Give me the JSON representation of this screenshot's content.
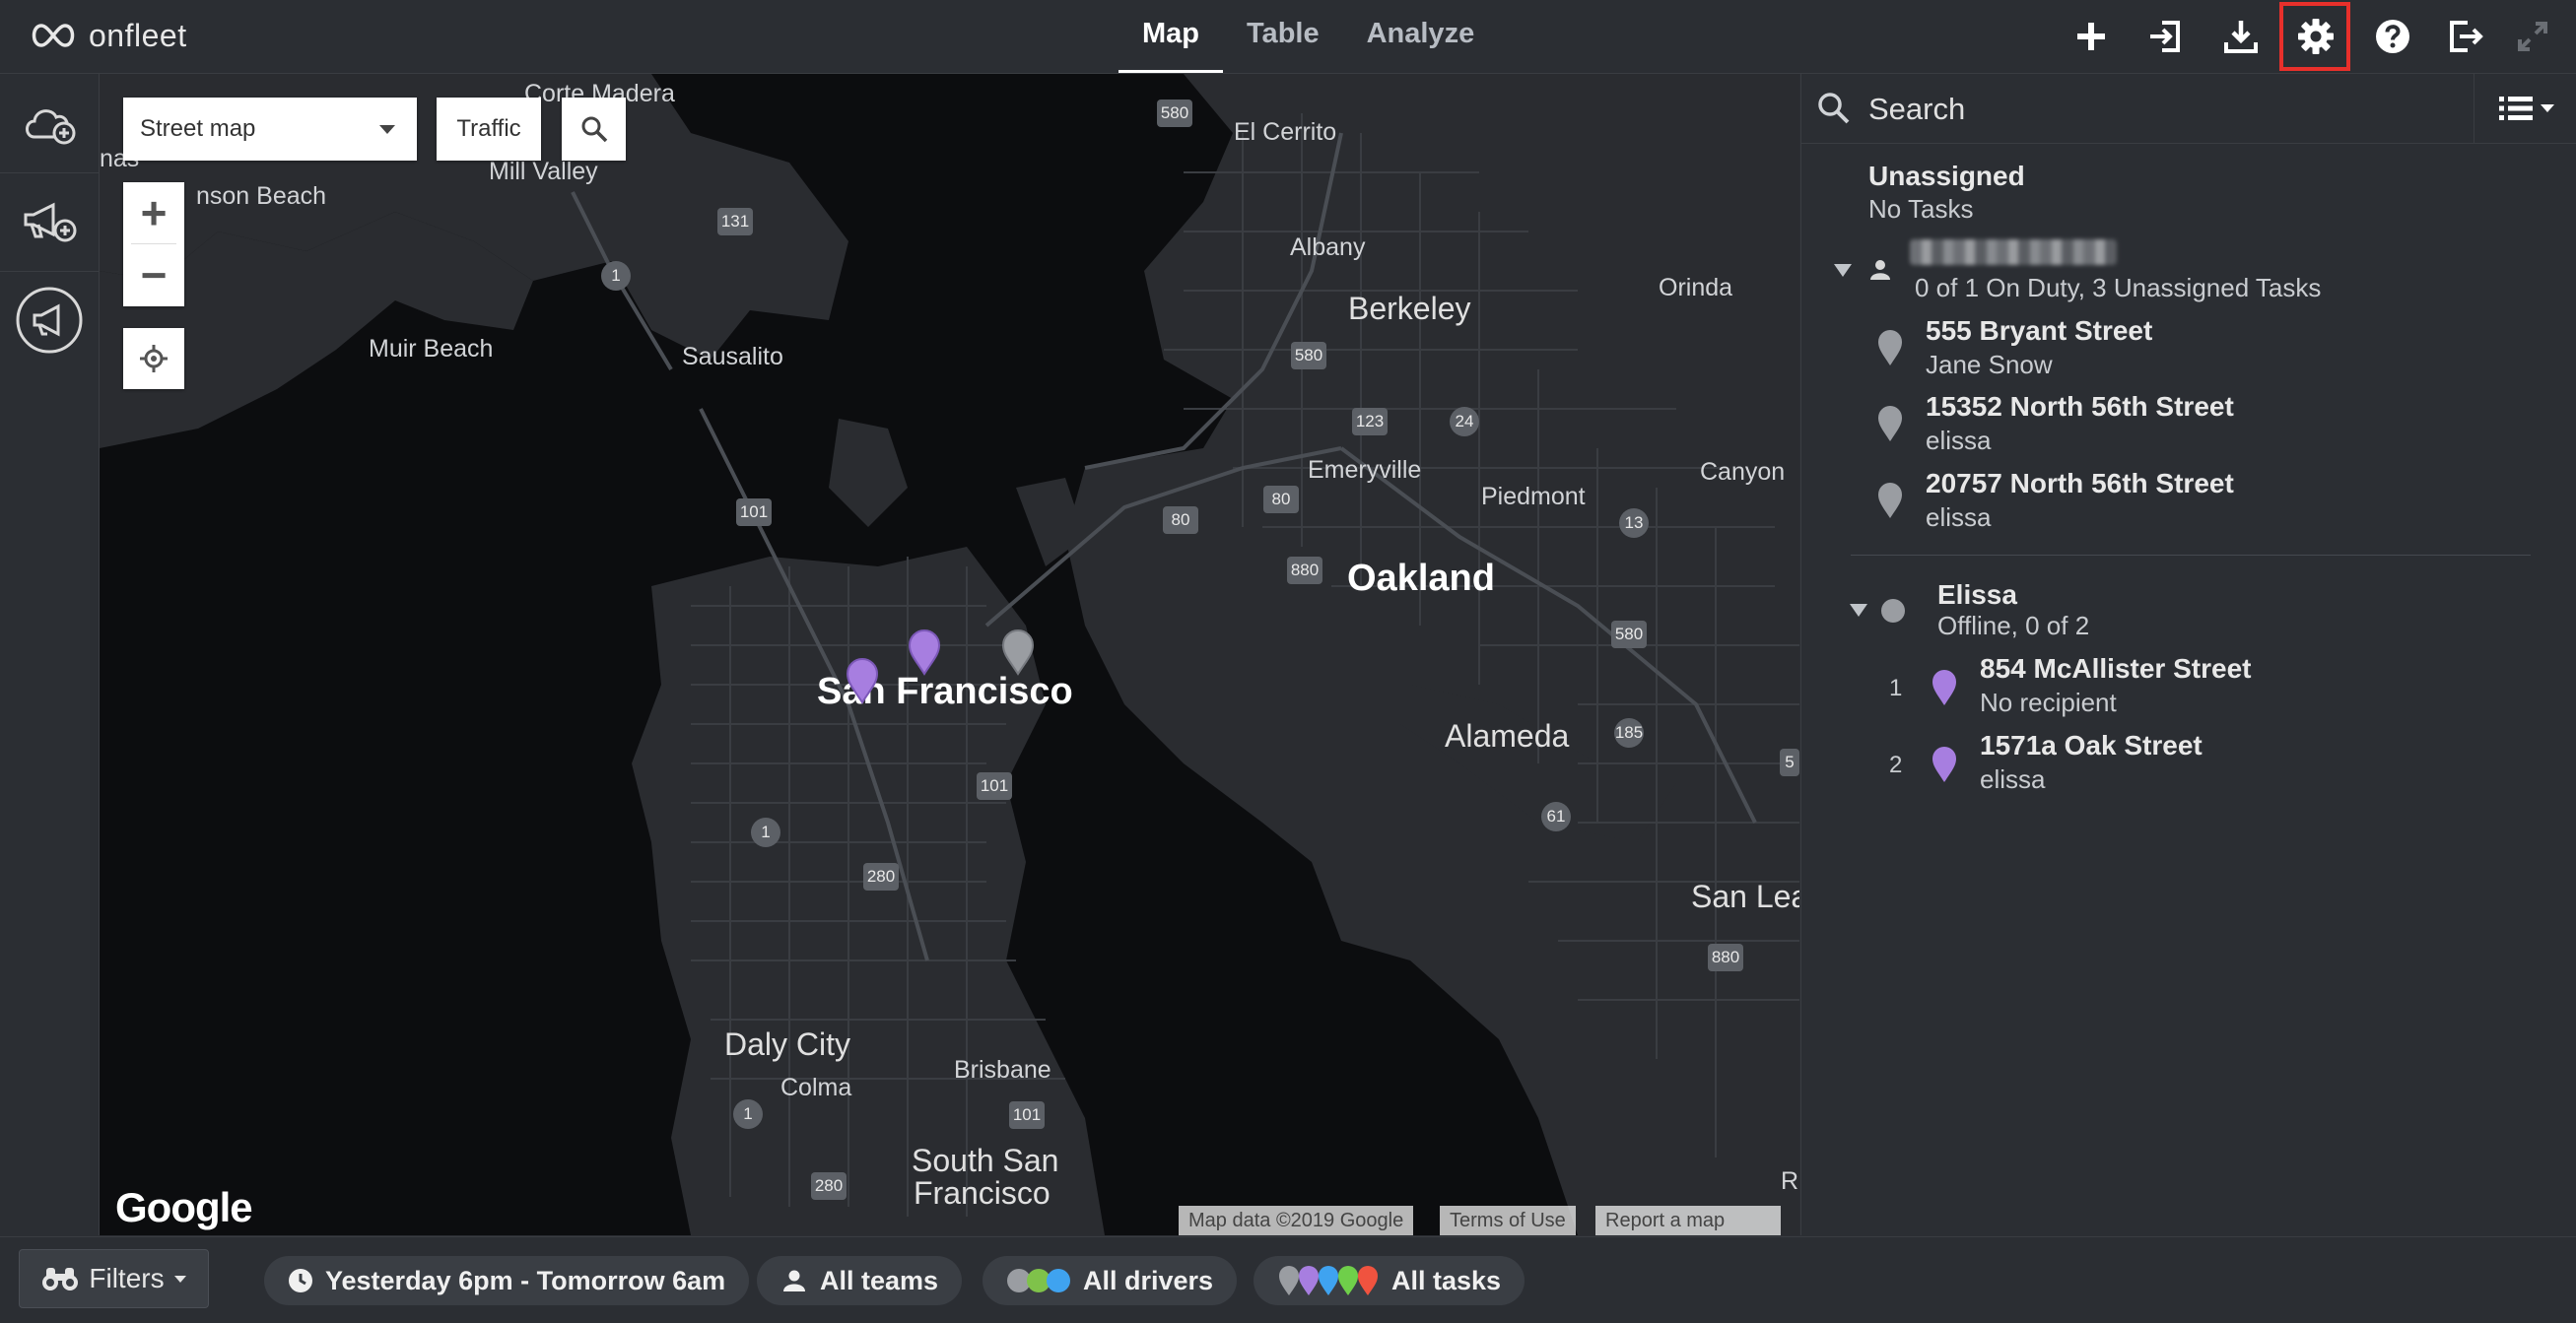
{
  "app": {
    "logo_text": "onfleet",
    "nav": [
      {
        "label": "Map",
        "active": true
      },
      {
        "label": "Table",
        "active": false
      },
      {
        "label": "Analyze",
        "active": false
      }
    ],
    "toolbar_icons": [
      "plus-icon",
      "import-icon",
      "download-icon",
      "gear-icon",
      "help-icon",
      "logout-icon",
      "fullscreen-icon"
    ],
    "highlight_color": "#e8302b"
  },
  "map": {
    "type_select": "Street map",
    "traffic_label": "Traffic",
    "zoom_in": "+",
    "zoom_out": "−",
    "google_logo": "Google",
    "attribution": {
      "data": "Map data ©2019 Google",
      "terms": "Terms of Use",
      "report": "Report a map error"
    },
    "labels": {
      "corte_madera": "Corte Madera",
      "mill_valley": "Mill Valley",
      "stinson_a": "nas",
      "stinson_b": "nson Beach",
      "muir_beach": "Muir Beach",
      "sausalito": "Sausalito",
      "el_cerrito": "El Cerrito",
      "albany": "Albany",
      "berkeley": "Berkeley",
      "orinda": "Orinda",
      "emeryville": "Emeryville",
      "piedmont": "Piedmont",
      "canyon": "Canyon",
      "oakland": "Oakland",
      "san_francisco": "San Francisco",
      "alameda": "Alameda",
      "san_leandro": "San Lea",
      "daly_city": "Daly City",
      "colma": "Colma",
      "brisbane": "Brisbane",
      "south_sf_1": "South San",
      "south_sf_2": "Francisco",
      "edge_r": "R"
    },
    "shields": {
      "s580a": "580",
      "s131": "131",
      "s1a": "1",
      "s580b": "580",
      "s123": "123",
      "s24": "24",
      "s101a": "101",
      "s80a": "80",
      "s80b": "80",
      "s880a": "880",
      "s13": "13",
      "s580c": "580",
      "s185": "185",
      "s101b": "101",
      "s1b": "1",
      "s280a": "280",
      "s61": "61",
      "s880b": "880",
      "s101c": "101",
      "s1c": "1",
      "s280b": "280",
      "s5": "5"
    }
  },
  "sidebar": {
    "search_placeholder": "Search",
    "unassigned": {
      "title": "Unassigned",
      "subtitle": "No Tasks"
    },
    "team": {
      "summary": "0 of 1 On Duty, 3 Unassigned Tasks",
      "tasks": [
        {
          "address": "555 Bryant Street",
          "recipient": "Jane Snow"
        },
        {
          "address": "15352 North 56th Street",
          "recipient": "elissa"
        },
        {
          "address": "20757 North 56th Street",
          "recipient": "elissa"
        }
      ]
    },
    "driver": {
      "name": "Elissa",
      "status": "Offline, 0 of 2",
      "tasks": [
        {
          "seq": "1",
          "address": "854 McAllister Street",
          "recipient": "No recipient"
        },
        {
          "seq": "2",
          "address": "1571a Oak Street",
          "recipient": "elissa"
        }
      ]
    },
    "pin_colors": {
      "unassigned": "#9a9da2",
      "assigned": "#a77ee0"
    }
  },
  "bottombar": {
    "filters_label": "Filters",
    "time_range": "Yesterday 6pm - Tomorrow 6am",
    "teams": "All teams",
    "drivers": "All drivers",
    "tasks": "All tasks",
    "driver_dot_colors": [
      "#9a9da2",
      "#7fc24a",
      "#3fa3f0"
    ],
    "task_pin_colors": [
      "#9a9da2",
      "#a77ee0",
      "#3fa3f0",
      "#6fcf4a",
      "#f0533f"
    ]
  }
}
